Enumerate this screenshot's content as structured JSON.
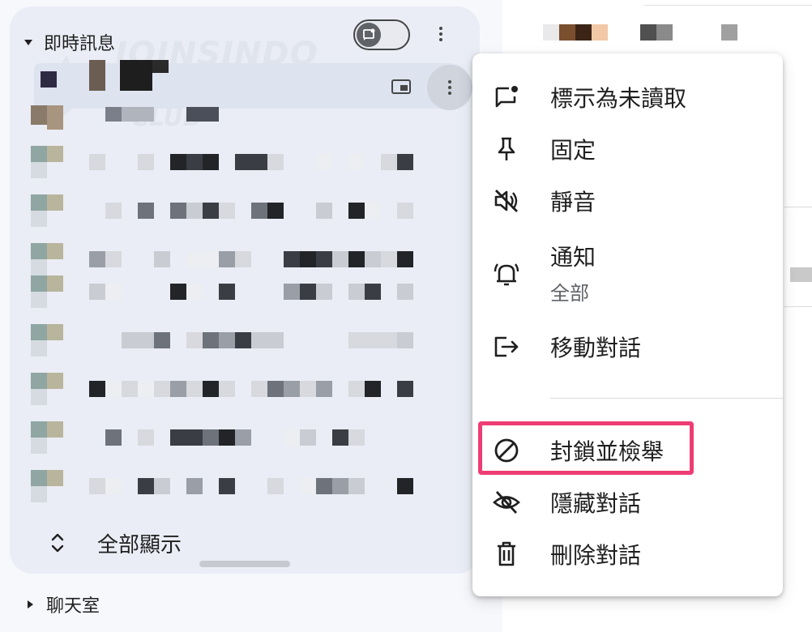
{
  "sidebar": {
    "direct_messages": {
      "title": "即時訊息",
      "toggle_icon": "chat-bubble-icon",
      "show_all_label": "全部顯示"
    },
    "spaces": {
      "title": "聊天室"
    }
  },
  "watermark": {
    "line1": "JOINSINDO",
    "line2": "CLUB"
  },
  "context_menu": {
    "items": [
      {
        "label": "標示為未讀取",
        "icon": "mark-unread-icon"
      },
      {
        "label": "固定",
        "icon": "pin-icon"
      },
      {
        "label": "靜音",
        "icon": "mute-icon"
      },
      {
        "label": "通知",
        "sublabel": "全部",
        "icon": "notification-bell-icon"
      },
      {
        "label": "移動對話",
        "icon": "move-conversation-icon"
      },
      {
        "label": "封鎖並檢舉",
        "icon": "block-icon"
      },
      {
        "label": "隱藏對話",
        "icon": "hide-icon"
      },
      {
        "label": "刪除對話",
        "icon": "trash-icon"
      }
    ]
  },
  "colors": {
    "panel_bg": "#eaedf5",
    "selected_row_bg": "#dde3ef",
    "highlight_border": "#ee3d74",
    "text": "#1f1f1f",
    "sublabel": "#5f6368"
  }
}
